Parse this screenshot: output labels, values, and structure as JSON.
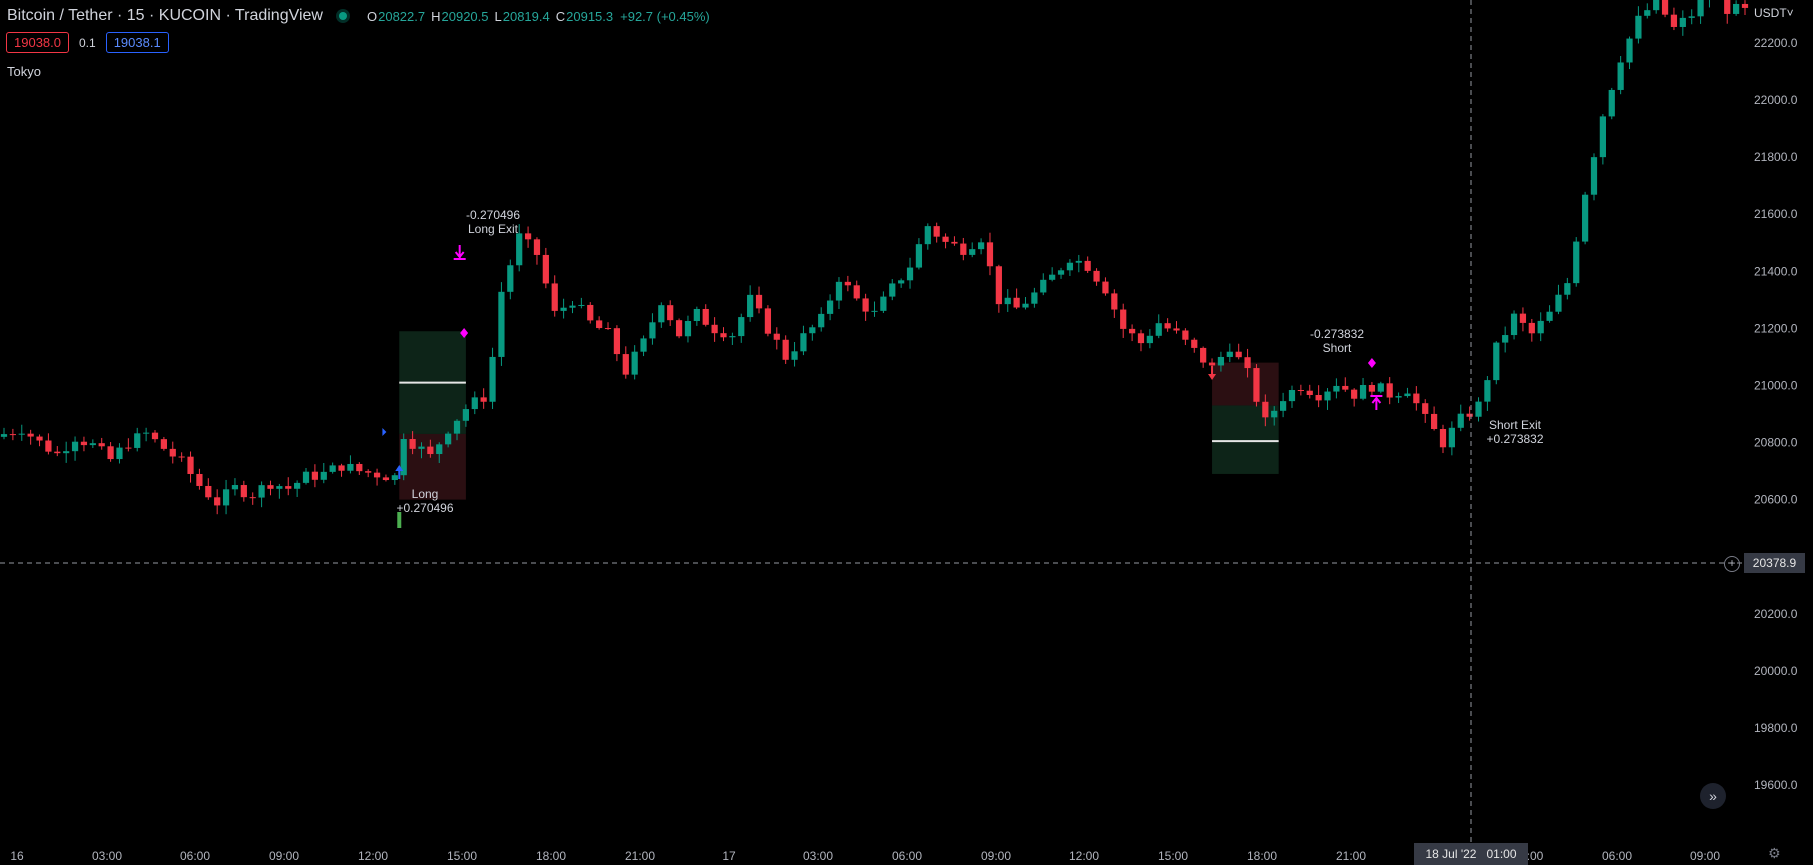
{
  "header": {
    "symbol_title": "Bitcoin / Tether · 15 · KUCOIN · TradingView",
    "ohlc": [
      {
        "key": "O",
        "value": "20822.7"
      },
      {
        "key": "H",
        "value": "20920.5"
      },
      {
        "key": "L",
        "value": "20819.4"
      },
      {
        "key": "C",
        "value": "20915.3"
      }
    ],
    "change": "+92.7 (+0.45%)"
  },
  "trade_panel": {
    "sell_price": "19038.0",
    "quantity": "0.1",
    "buy_price": "19038.1"
  },
  "session_label": "Tokyo",
  "currency_label": "USDT˅",
  "crosshair": {
    "price": "20378.9",
    "time_date": "18 Jul '22",
    "time_clock": "01:00"
  },
  "colors": {
    "up": "#089981",
    "down": "#f23645",
    "signal": "#ff00ff",
    "long_arrow": "#2962ff"
  },
  "icons": {
    "gear": "gear-icon",
    "scroll_to_realtime": "chevrons-right-icon",
    "add": "plus-circle-icon"
  },
  "chart_data": {
    "type": "candlestick",
    "y_axis": {
      "ticks": [
        "22200.0",
        "22000.0",
        "21800.0",
        "21600.0",
        "21400.0",
        "21200.0",
        "21000.0",
        "20800.0",
        "20600.0",
        "20200.0",
        "20000.0",
        "19800.0",
        "19600.0"
      ],
      "range": [
        19450,
        22300
      ]
    },
    "x_axis": {
      "ticks": [
        "16",
        "03:00",
        "06:00",
        "09:00",
        "12:00",
        "15:00",
        "18:00",
        "21:00",
        "17",
        "03:00",
        "06:00",
        "09:00",
        "12:00",
        "15:00",
        "18:00",
        "21:00",
        ":00",
        "06:00",
        "09:00"
      ],
      "index_range": [
        0,
        196
      ]
    },
    "close_series": [
      [
        0,
        20830
      ],
      [
        2,
        20850
      ],
      [
        4,
        20800
      ],
      [
        6,
        20760
      ],
      [
        8,
        20820
      ],
      [
        10,
        20790
      ],
      [
        12,
        20740
      ],
      [
        14,
        20800
      ],
      [
        16,
        20830
      ],
      [
        18,
        20780
      ],
      [
        20,
        20730
      ],
      [
        22,
        20650
      ],
      [
        24,
        20590
      ],
      [
        26,
        20640
      ],
      [
        28,
        20620
      ],
      [
        30,
        20660
      ],
      [
        32,
        20640
      ],
      [
        34,
        20680
      ],
      [
        36,
        20690
      ],
      [
        38,
        20720
      ],
      [
        40,
        20700
      ],
      [
        42,
        20690
      ],
      [
        44,
        20680
      ],
      [
        45,
        20830
      ],
      [
        46,
        20800
      ],
      [
        48,
        20750
      ],
      [
        50,
        20850
      ],
      [
        52,
        20920
      ],
      [
        54,
        20960
      ],
      [
        55,
        21100
      ],
      [
        56,
        21330
      ],
      [
        58,
        21520
      ],
      [
        60,
        21460
      ],
      [
        62,
        21250
      ],
      [
        64,
        21300
      ],
      [
        66,
        21220
      ],
      [
        68,
        21180
      ],
      [
        70,
        21050
      ],
      [
        72,
        21150
      ],
      [
        74,
        21300
      ],
      [
        76,
        21180
      ],
      [
        78,
        21250
      ],
      [
        80,
        21200
      ],
      [
        82,
        21180
      ],
      [
        84,
        21300
      ],
      [
        86,
        21200
      ],
      [
        88,
        21100
      ],
      [
        90,
        21170
      ],
      [
        92,
        21230
      ],
      [
        94,
        21380
      ],
      [
        96,
        21300
      ],
      [
        98,
        21250
      ],
      [
        100,
        21340
      ],
      [
        102,
        21420
      ],
      [
        104,
        21560
      ],
      [
        106,
        21500
      ],
      [
        108,
        21480
      ],
      [
        110,
        21520
      ],
      [
        112,
        21300
      ],
      [
        114,
        21270
      ],
      [
        116,
        21320
      ],
      [
        118,
        21380
      ],
      [
        120,
        21450
      ],
      [
        122,
        21420
      ],
      [
        124,
        21340
      ],
      [
        126,
        21200
      ],
      [
        128,
        21150
      ],
      [
        130,
        21220
      ],
      [
        132,
        21180
      ],
      [
        134,
        21120
      ],
      [
        136,
        21060
      ],
      [
        138,
        21140
      ],
      [
        140,
        21040
      ],
      [
        142,
        20870
      ],
      [
        144,
        20960
      ],
      [
        146,
        21000
      ],
      [
        148,
        20970
      ],
      [
        150,
        21010
      ],
      [
        152,
        20970
      ],
      [
        154,
        21000
      ],
      [
        156,
        20970
      ],
      [
        158,
        20990
      ],
      [
        160,
        20880
      ],
      [
        162,
        20800
      ],
      [
        164,
        20880
      ],
      [
        166,
        20930
      ],
      [
        168,
        21130
      ],
      [
        170,
        21240
      ],
      [
        172,
        21180
      ],
      [
        174,
        21250
      ],
      [
        176,
        21360
      ],
      [
        178,
        21680
      ],
      [
        180,
        21950
      ],
      [
        182,
        22150
      ],
      [
        184,
        22280
      ],
      [
        186,
        22350
      ],
      [
        188,
        22250
      ],
      [
        190,
        22300
      ],
      [
        192,
        22380
      ],
      [
        194,
        22320
      ],
      [
        196,
        22310
      ]
    ],
    "annotations": [
      {
        "id": "long-entry",
        "lines": [
          "Long",
          "+0.270496"
        ]
      },
      {
        "id": "long-exit",
        "lines": [
          "-0.270496",
          "Long Exit"
        ]
      },
      {
        "id": "short-entry",
        "lines": [
          "-0.273832",
          "Short"
        ]
      },
      {
        "id": "short-exit",
        "lines": [
          "Short Exit",
          "+0.273832"
        ]
      }
    ]
  }
}
